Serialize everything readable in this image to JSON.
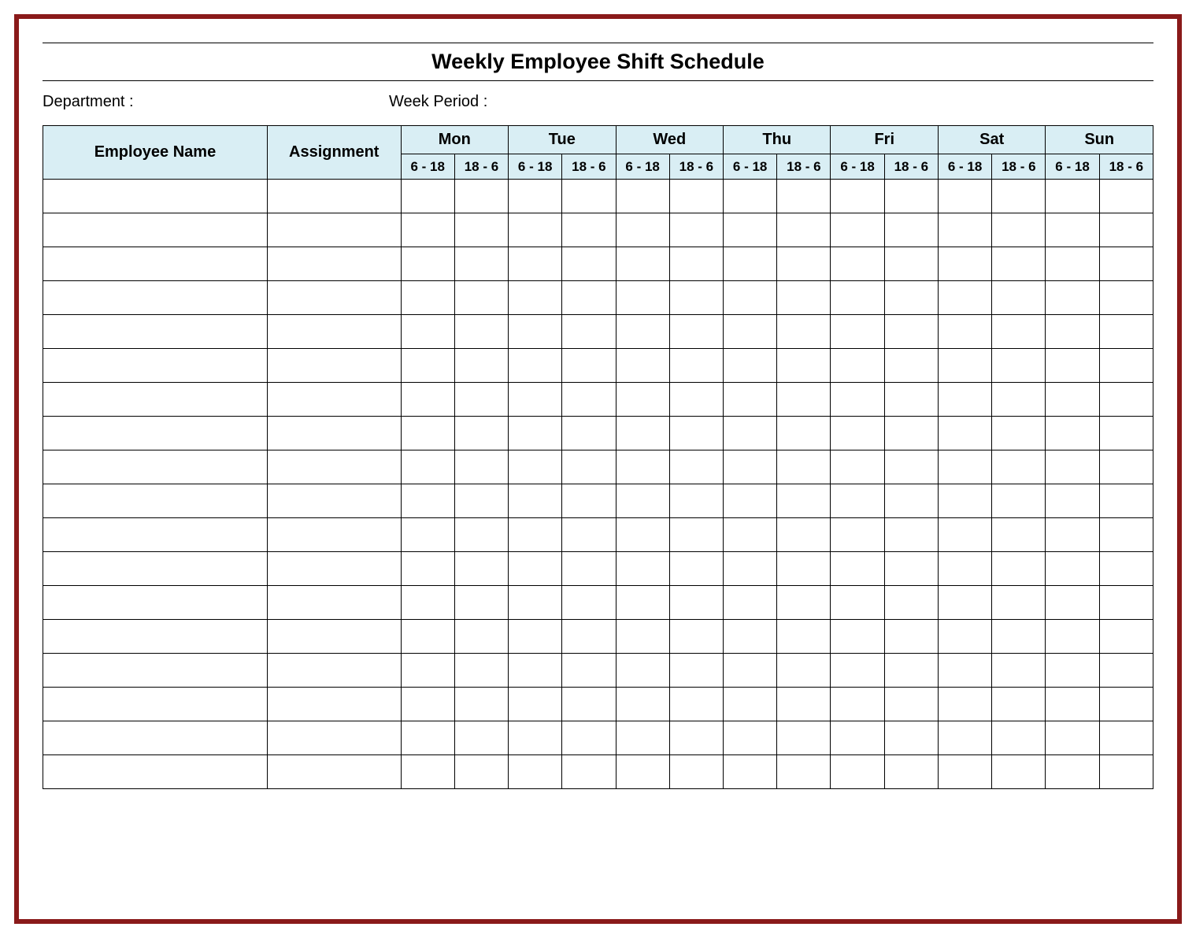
{
  "title": "Weekly Employee Shift Schedule",
  "meta": {
    "department_label": "Department :",
    "week_period_label": "Week  Period :"
  },
  "columns": {
    "employee_name": "Employee Name",
    "assignment": "Assignment"
  },
  "days": [
    "Mon",
    "Tue",
    "Wed",
    "Thu",
    "Fri",
    "Sat",
    "Sun"
  ],
  "shifts": [
    "6 - 18",
    "18 - 6"
  ],
  "row_count": 18,
  "colors": {
    "frame_border": "#8a1a1a",
    "header_bg": "#d9eef4"
  }
}
